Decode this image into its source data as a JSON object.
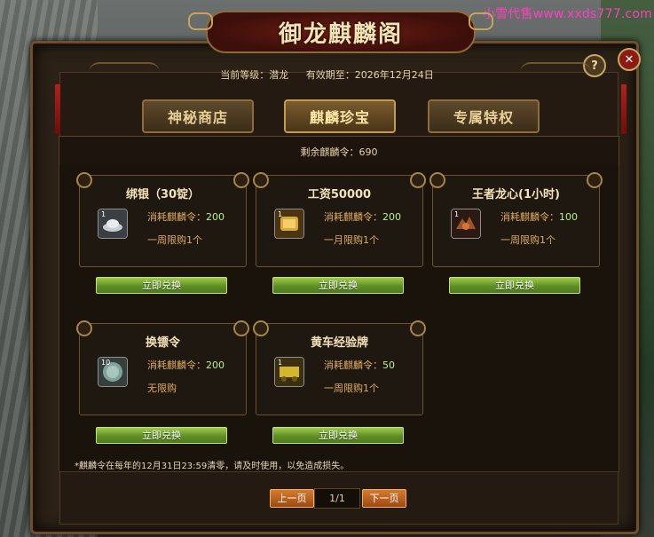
{
  "watermark": "小雪代售www.xxds777.com",
  "window": {
    "title": "御龙麒麟阁"
  },
  "info": {
    "level_text": "当前等级：潜龙",
    "expiry_text": "有效期至：2026年12月24日"
  },
  "tabs": [
    {
      "label": "神秘商店",
      "active": false
    },
    {
      "label": "麒麟珍宝",
      "active": true
    },
    {
      "label": "专属特权",
      "active": false
    }
  ],
  "remaining": "剩余麒麟令：690",
  "cost_label": "消耗麒麟令：",
  "items": [
    {
      "title": "绑银（30锭）",
      "icon": "silver-ingot-icon",
      "qty": "1",
      "cost": "200",
      "limit": "一周限购1个"
    },
    {
      "title": "工资50000",
      "icon": "gold-scroll-icon",
      "qty": "1",
      "cost": "200",
      "limit": "一月限购1个"
    },
    {
      "title": "王者龙心(1小时)",
      "icon": "dragon-heart-icon",
      "qty": "1",
      "cost": "100",
      "limit": "一周限购1个"
    },
    {
      "title": "换镖令",
      "icon": "escort-token-icon",
      "qty": "10",
      "cost": "200",
      "limit": "无限购"
    },
    {
      "title": "黄车经验牌",
      "icon": "yellow-cart-exp-icon",
      "qty": "1",
      "cost": "50",
      "limit": "一周限购1个"
    }
  ],
  "redeem_label": "立即兑换",
  "note": "*麒麟令在每年的12月31日23:59清零，请及时使用，以免造成损失。",
  "pagination": {
    "prev": "上一页",
    "page": "1/1",
    "next": "下一页"
  },
  "buttons": {
    "help": "?",
    "close": "✕"
  },
  "colors": {
    "accent_gold": "#e0ab62",
    "cost_green": "#b6f08a",
    "redeem_green": "#5f8f26",
    "page_orange": "#d77a2c"
  }
}
